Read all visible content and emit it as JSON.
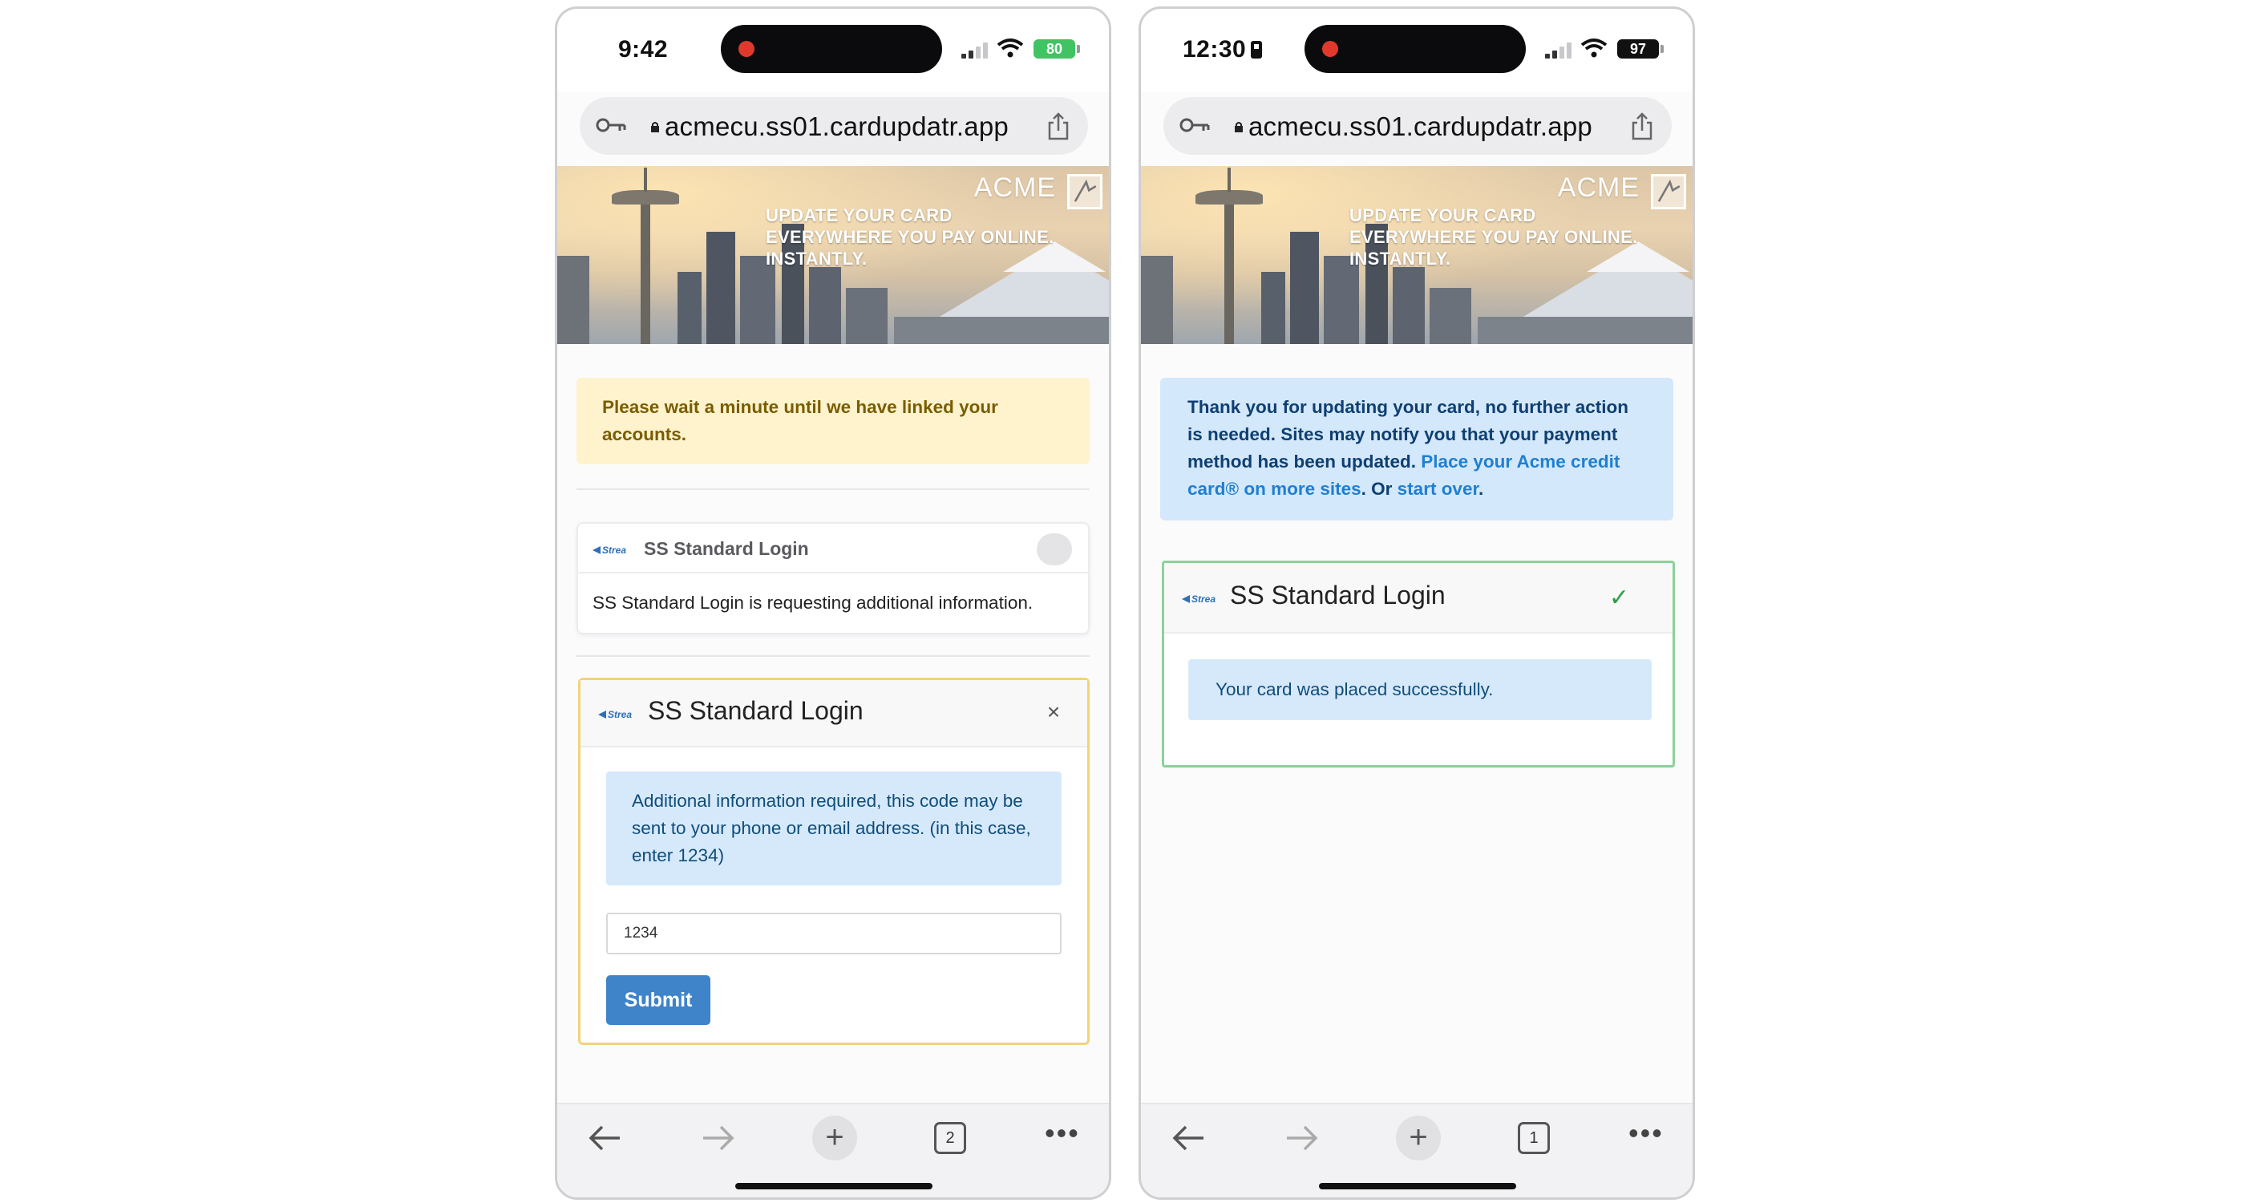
{
  "left_phone": {
    "status": {
      "time": "9:42",
      "battery": "80"
    },
    "browser": {
      "url": "acmecu.ss01.cardupdatr.app",
      "tabs_count": "2"
    },
    "hero": {
      "lines": [
        "UPDATE YOUR CARD",
        "EVERYWHERE YOU PAY ONLINE.",
        "INSTANTLY."
      ],
      "brand": "ACME"
    },
    "wait_alert": "Please wait a minute until we have linked your accounts.",
    "site_card": {
      "logo_text": "Strea",
      "title": "SS Standard Login",
      "message": "SS Standard Login is requesting additional information."
    },
    "mfa_card": {
      "logo_text": "Strea",
      "title": "SS Standard Login",
      "close_label": "×",
      "info": "Additional information required, this code may be sent to your phone or email address. (in this case, enter 1234)",
      "input_value": "1234",
      "submit_label": "Submit"
    }
  },
  "right_phone": {
    "status": {
      "time": "12:30",
      "battery": "97"
    },
    "browser": {
      "url": "acmecu.ss01.cardupdatr.app",
      "tabs_count": "1"
    },
    "hero": {
      "lines": [
        "UPDATE YOUR CARD",
        "EVERYWHERE YOU PAY ONLINE.",
        "INSTANTLY."
      ],
      "brand": "ACME"
    },
    "thanks_alert": {
      "text": "Thank you for updating your card, no further action is needed. Sites may notify you that your payment method has been updated.",
      "link_place": "Place your Acme credit card® on more sites",
      "or_text": ". Or ",
      "link_start": "start over",
      "end": "."
    },
    "success_card": {
      "logo_text": "Strea",
      "title": "SS Standard Login",
      "check": "✓",
      "message": "Your card was placed successfully."
    }
  },
  "colors": {
    "warning_bg": "#fef3cd",
    "info_bg": "#d6e9fb",
    "primary": "#3f83c9",
    "success_border": "#8bd19a"
  },
  "icons": [
    "key-icon",
    "lock-icon",
    "share-icon",
    "back-arrow-icon",
    "forward-arrow-icon",
    "plus-icon",
    "tabs-icon",
    "more-icon",
    "close-icon",
    "check-icon",
    "wifi-icon",
    "signal-icon",
    "battery-icon"
  ]
}
